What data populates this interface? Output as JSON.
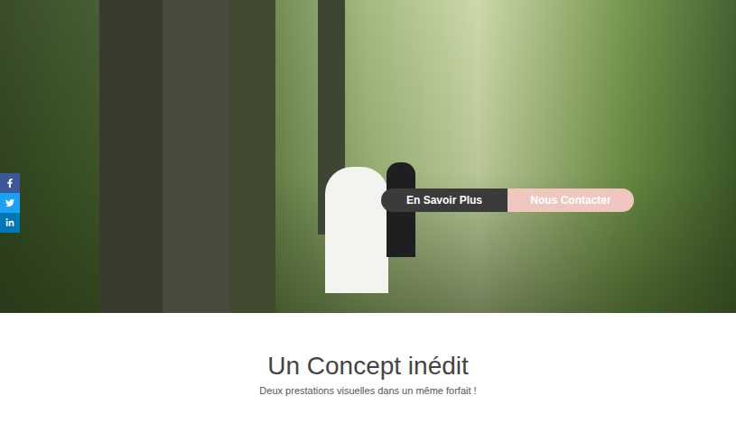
{
  "hero": {
    "buttons": [
      {
        "label": "En Savoir Plus",
        "color": "#3b3b3b"
      },
      {
        "label": "Nous Contacter",
        "color": "#f0c7bf"
      }
    ]
  },
  "section": {
    "title": "Un Concept inédit",
    "subtitle": "Deux prestations visuelles dans un même forfait !"
  }
}
